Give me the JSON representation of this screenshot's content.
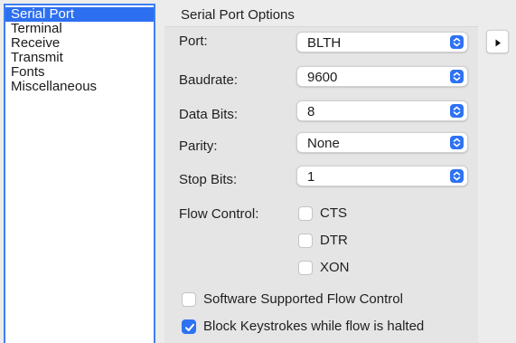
{
  "sidebar": {
    "items": [
      {
        "label": "Serial Port",
        "selected": true
      },
      {
        "label": "Terminal"
      },
      {
        "label": "Receive"
      },
      {
        "label": "Transmit"
      },
      {
        "label": "Fonts"
      },
      {
        "label": "Miscellaneous"
      }
    ]
  },
  "options": {
    "title": "Serial Port Options",
    "port": {
      "label": "Port:",
      "value": "BLTH"
    },
    "baudrate": {
      "label": "Baudrate:",
      "value": "9600"
    },
    "data_bits": {
      "label": "Data Bits:",
      "value": "8"
    },
    "parity": {
      "label": "Parity:",
      "value": "None"
    },
    "stop_bits": {
      "label": "Stop Bits:",
      "value": "1"
    },
    "flow_control": {
      "label": "Flow Control:",
      "cts": {
        "label": "CTS",
        "checked": false
      },
      "dtr": {
        "label": "DTR",
        "checked": false
      },
      "xon": {
        "label": "XON",
        "checked": false
      }
    },
    "software_flow": {
      "label": "Software Supported Flow Control",
      "checked": false
    },
    "block_keystrokes": {
      "label": "Block Keystrokes while flow is halted",
      "checked": true
    }
  },
  "colors": {
    "accent": "#2e72f3",
    "sidebar_border": "#3e7ff3",
    "selection": "#2c6ff0"
  }
}
